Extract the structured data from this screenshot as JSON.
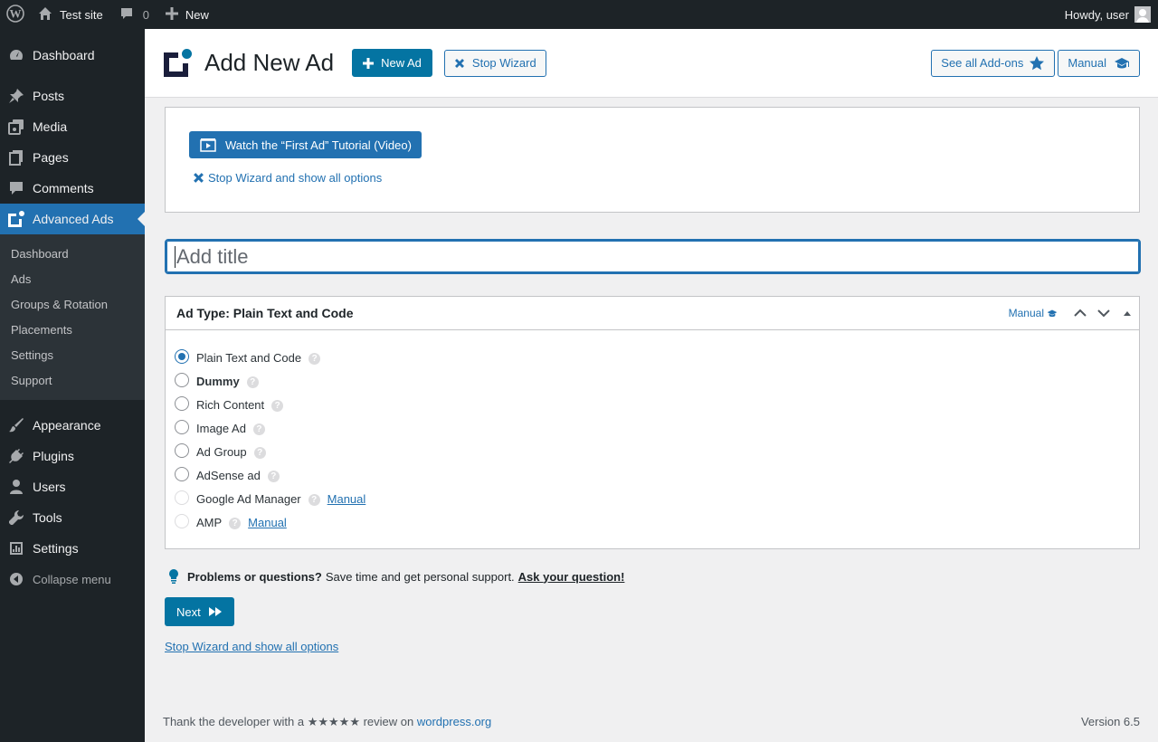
{
  "adminbar": {
    "site_name": "Test site",
    "comments_count": "0",
    "new_label": "New",
    "howdy": "Howdy, user",
    "icons": [
      "wordpress-icon",
      "home-icon",
      "comment-icon",
      "plus-icon"
    ]
  },
  "sidebar": {
    "items": [
      {
        "label": "Dashboard",
        "icon": "dashboard-icon"
      },
      {
        "label": "Posts",
        "icon": "pin-icon"
      },
      {
        "label": "Media",
        "icon": "media-icon"
      },
      {
        "label": "Pages",
        "icon": "pages-icon"
      },
      {
        "label": "Comments",
        "icon": "comment-icon"
      },
      {
        "label": "Advanced Ads",
        "icon": "advanced-ads-icon"
      },
      {
        "label": "Appearance",
        "icon": "brush-icon"
      },
      {
        "label": "Plugins",
        "icon": "plug-icon"
      },
      {
        "label": "Users",
        "icon": "user-icon"
      },
      {
        "label": "Tools",
        "icon": "wrench-icon"
      },
      {
        "label": "Settings",
        "icon": "settings-icon"
      }
    ],
    "submenu": [
      "Dashboard",
      "Ads",
      "Groups & Rotation",
      "Placements",
      "Settings",
      "Support"
    ],
    "collapse": "Collapse menu"
  },
  "header": {
    "title": "Add New Ad",
    "new_ad": "New Ad",
    "stop_wizard": "Stop Wizard",
    "see_addons": "See all Add-ons",
    "manual": "Manual"
  },
  "wizard": {
    "video_button": "Watch the “First Ad” Tutorial (Video)",
    "stop_link": "Stop Wizard and show all options"
  },
  "title_field": {
    "placeholder": "Add title",
    "value": ""
  },
  "ad_type_box": {
    "title": "Ad Type: Plain Text and Code",
    "manual": "Manual",
    "types": [
      {
        "label": "Plain Text and Code",
        "checked": true,
        "bold": false,
        "disabled": false,
        "manual": ""
      },
      {
        "label": "Dummy",
        "checked": false,
        "bold": true,
        "disabled": false,
        "manual": ""
      },
      {
        "label": "Rich Content",
        "checked": false,
        "bold": false,
        "disabled": false,
        "manual": ""
      },
      {
        "label": "Image Ad",
        "checked": false,
        "bold": false,
        "disabled": false,
        "manual": ""
      },
      {
        "label": "Ad Group",
        "checked": false,
        "bold": false,
        "disabled": false,
        "manual": ""
      },
      {
        "label": "AdSense ad",
        "checked": false,
        "bold": false,
        "disabled": false,
        "manual": ""
      },
      {
        "label": "Google Ad Manager",
        "checked": false,
        "bold": false,
        "disabled": true,
        "manual": "Manual"
      },
      {
        "label": "AMP",
        "checked": false,
        "bold": false,
        "disabled": true,
        "manual": "Manual"
      }
    ]
  },
  "support": {
    "bold": "Problems or questions?",
    "text": "Save time and get personal support.",
    "link": "Ask your question!"
  },
  "next_button": "Next",
  "stop_bottom": "Stop Wizard and show all options",
  "footer": {
    "thanks_prefix": "Thank the developer with a ★★★★★ review on",
    "link": "wordpress.org",
    "version": "Version 6.5"
  },
  "colors": {
    "accent": "#2271b1",
    "brand": "#0474a2",
    "sidebar_bg": "#1d2327"
  }
}
